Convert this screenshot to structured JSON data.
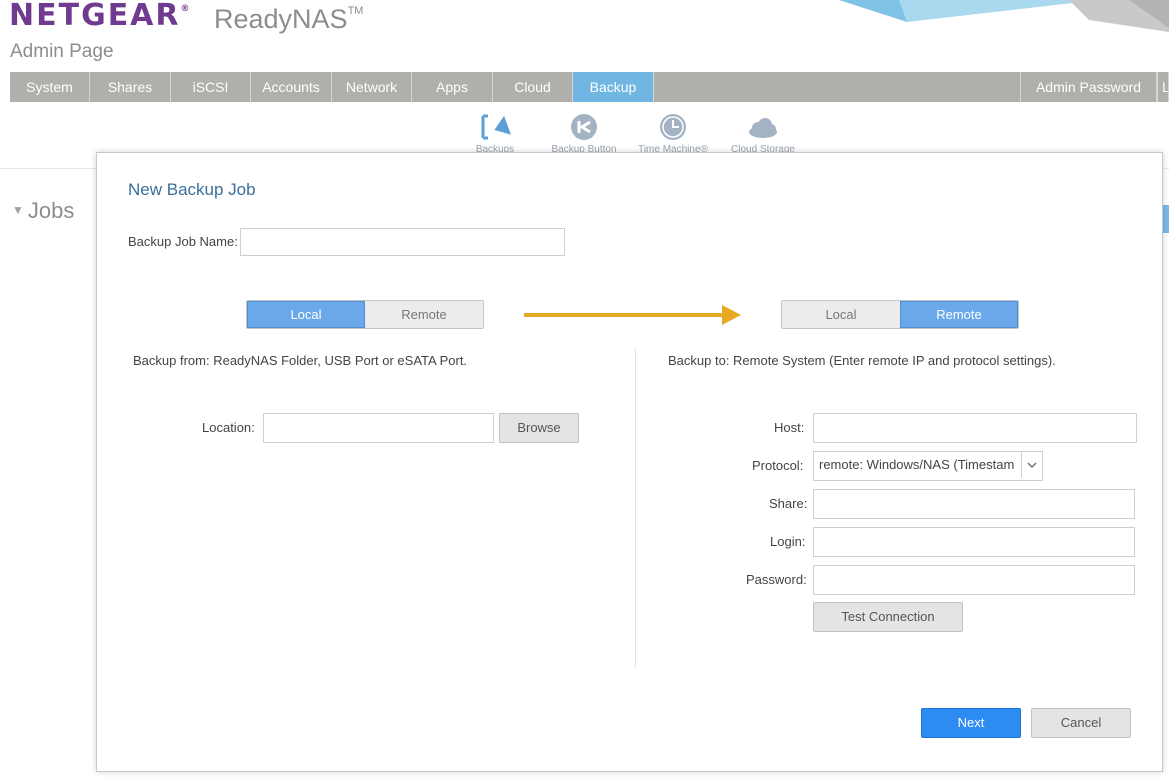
{
  "header": {
    "brand": "NETGEAR",
    "brand_mark": "®",
    "product": "ReadyNAS",
    "product_mark": "TM",
    "subtitle": "Admin Page"
  },
  "nav": {
    "tabs": [
      "System",
      "Shares",
      "iSCSI",
      "Accounts",
      "Network",
      "Apps",
      "Cloud",
      "Backup"
    ],
    "active": "Backup",
    "right_tabs": [
      "Admin Password",
      "L"
    ]
  },
  "subnav": [
    {
      "label": "Backups",
      "icon": "backup-arrow-icon"
    },
    {
      "label": "Backup Button",
      "icon": "backup-button-icon"
    },
    {
      "label": "Time Machine®",
      "icon": "clock-icon"
    },
    {
      "label": "Cloud Storage",
      "icon": "cloud-icon"
    }
  ],
  "background": {
    "jobs_heading": "Jobs"
  },
  "dialog": {
    "title": "New Backup Job",
    "job_name_label": "Backup Job Name:",
    "job_name_value": "",
    "source": {
      "options": [
        "Local",
        "Remote"
      ],
      "selected": "Local",
      "description": "Backup from: ReadyNAS Folder, USB Port or eSATA Port.",
      "location_label": "Location:",
      "location_value": "",
      "browse_label": "Browse"
    },
    "destination": {
      "options": [
        "Local",
        "Remote"
      ],
      "selected": "Remote",
      "description": "Backup to: Remote System (Enter remote IP and protocol settings).",
      "host_label": "Host:",
      "protocol_label": "Protocol:",
      "protocol_value": "remote: Windows/NAS (Timestam",
      "share_label": "Share:",
      "login_label": "Login:",
      "password_label": "Password:",
      "test_label": "Test Connection"
    },
    "next_label": "Next",
    "cancel_label": "Cancel"
  },
  "colors": {
    "brand": "#6f3a8f",
    "nav": "#b0afab",
    "nav_active": "#71b6e3",
    "toggle_on": "#6aa8ea",
    "primary": "#2c8cf2",
    "arrow": "#e8a922"
  }
}
